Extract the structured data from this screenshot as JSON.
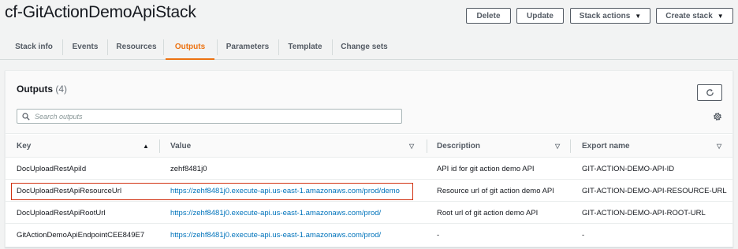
{
  "header": {
    "title": "cf-GitActionDemoApiStack",
    "buttons": {
      "delete": "Delete",
      "update": "Update",
      "stack_actions": "Stack actions",
      "create_stack": "Create stack"
    }
  },
  "tabs": [
    "Stack info",
    "Events",
    "Resources",
    "Outputs",
    "Parameters",
    "Template",
    "Change sets"
  ],
  "active_tab": "Outputs",
  "outputs": {
    "title": "Outputs",
    "count": "(4)",
    "search_placeholder": "Search outputs",
    "columns": [
      "Key",
      "Value",
      "Description",
      "Export name"
    ],
    "rows": [
      {
        "key": "DocUploadRestApiId",
        "value": "zehf8481j0",
        "description": "API id for git action demo API",
        "export": "GIT-ACTION-DEMO-API-ID"
      },
      {
        "key": "DocUploadRestApiResourceUrl",
        "value": "https://zehf8481j0.execute-api.us-east-1.amazonaws.com/prod/demo",
        "description": "Resource url of git action demo API",
        "export": "GIT-ACTION-DEMO-API-RESOURCE-URL"
      },
      {
        "key": "DocUploadRestApiRootUrl",
        "value": "https://zehf8481j0.execute-api.us-east-1.amazonaws.com/prod/",
        "description": "Root url of git action demo API",
        "export": "GIT-ACTION-DEMO-API-ROOT-URL"
      },
      {
        "key": "GitActionDemoApiEndpointCEE849E7",
        "value": "https://zehf8481j0.execute-api.us-east-1.amazonaws.com/prod/",
        "description": "-",
        "export": "-"
      }
    ]
  },
  "colors": {
    "accent": "#ec7211",
    "link": "#0073bb",
    "highlight": "#d13212"
  }
}
